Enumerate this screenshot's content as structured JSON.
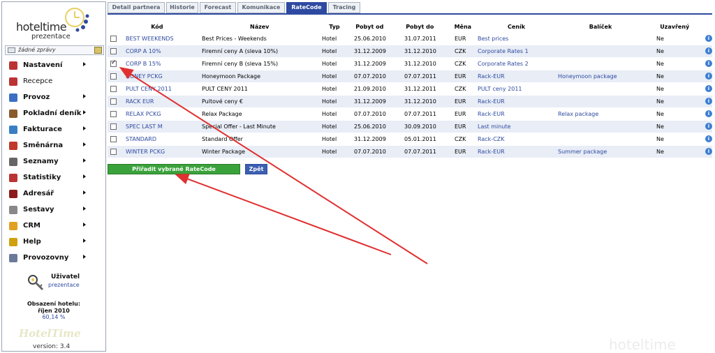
{
  "app": {
    "logo_main": "hoteltime",
    "logo_sub": "prezentace",
    "version": "version: 3.4",
    "watermark": "hoteltime",
    "bottom_logo": "HotelTime"
  },
  "messages": {
    "text": "žádné zprávy"
  },
  "menu": [
    {
      "label": "Nastavení",
      "icon": "gear-icon",
      "arrow": true,
      "color": "#b33"
    },
    {
      "label": "Recepce",
      "icon": "reception-icon",
      "arrow": false,
      "color": "#b33"
    },
    {
      "label": "Provoz",
      "icon": "globe-icon",
      "arrow": true,
      "color": "#3a6fc4"
    },
    {
      "label": "Pokladní deník",
      "icon": "cashbook-icon",
      "arrow": true,
      "color": "#8a5a2a"
    },
    {
      "label": "Fakturace",
      "icon": "invoice-icon",
      "arrow": true,
      "color": "#3a7fc4"
    },
    {
      "label": "Směnárna",
      "icon": "exchange-icon",
      "arrow": true,
      "color": "#c0392b"
    },
    {
      "label": "Seznamy",
      "icon": "list-icon",
      "arrow": true,
      "color": "#666"
    },
    {
      "label": "Statistiky",
      "icon": "chart-icon",
      "arrow": true,
      "color": "#b33"
    },
    {
      "label": "Adresář",
      "icon": "addressbook-icon",
      "arrow": true,
      "color": "#8b1a1a"
    },
    {
      "label": "Sestavy",
      "icon": "printer-icon",
      "arrow": true,
      "color": "#888"
    },
    {
      "label": "CRM",
      "icon": "crm-icon",
      "arrow": true,
      "color": "#e0a020"
    },
    {
      "label": "Help",
      "icon": "help-icon",
      "arrow": true,
      "color": "#d0a010"
    },
    {
      "label": "Provozovny",
      "icon": "building-icon",
      "arrow": true,
      "color": "#6a7a9a"
    }
  ],
  "user": {
    "title": "Uživatel",
    "name": "prezentace"
  },
  "occupancy": {
    "title": "Obsazení hotelu:",
    "month": "říjen 2010",
    "value": "60,14 %"
  },
  "tabs": [
    "Detail partnera",
    "Historie",
    "Forecast",
    "Komunikace",
    "RateCode",
    "Tracing"
  ],
  "active_tab": "RateCode",
  "table": {
    "headers": [
      "Kód",
      "Název",
      "Typ",
      "Pobyt od",
      "Pobyt do",
      "Měna",
      "Ceník",
      "Balíček",
      "Uzavřený"
    ],
    "rows": [
      {
        "checked": false,
        "code": "BEST WEEKENDS",
        "name": "Best Prices - Weekends",
        "type": "Hotel",
        "from": "25.06.2010",
        "to": "31.07.2011",
        "currency": "EUR",
        "pricelist": "Best prices",
        "package": "",
        "closed": "Ne"
      },
      {
        "checked": false,
        "code": "CORP A 10%",
        "name": "Firemní ceny A (sleva 10%)",
        "type": "Hotel",
        "from": "31.12.2009",
        "to": "31.12.2010",
        "currency": "CZK",
        "pricelist": "Corporate Rates 1",
        "package": "",
        "closed": "Ne"
      },
      {
        "checked": true,
        "code": "CORP B 15%",
        "name": "Firemní ceny B (sleva 15%)",
        "type": "Hotel",
        "from": "31.12.2009",
        "to": "31.12.2010",
        "currency": "CZK",
        "pricelist": "Corporate Rates 2",
        "package": "",
        "closed": "Ne"
      },
      {
        "checked": false,
        "code": "HONEY PCKG",
        "name": "Honeymoon Package",
        "type": "Hotel",
        "from": "07.07.2010",
        "to": "07.07.2011",
        "currency": "EUR",
        "pricelist": "Rack-EUR",
        "package": "Honeymoon package",
        "closed": "Ne"
      },
      {
        "checked": false,
        "code": "PULT CENY 2011",
        "name": "PULT CENY 2011",
        "type": "Hotel",
        "from": "21.09.2010",
        "to": "31.12.2011",
        "currency": "CZK",
        "pricelist": "PULT ceny 2011",
        "package": "",
        "closed": "Ne"
      },
      {
        "checked": false,
        "code": "RACK EUR",
        "name": "Pultové ceny €",
        "type": "Hotel",
        "from": "31.12.2009",
        "to": "31.12.2010",
        "currency": "EUR",
        "pricelist": "Rack-EUR",
        "package": "",
        "closed": "Ne"
      },
      {
        "checked": false,
        "code": "RELAX PCKG",
        "name": "Relax Package",
        "type": "Hotel",
        "from": "07.07.2010",
        "to": "07.07.2011",
        "currency": "EUR",
        "pricelist": "Rack-EUR",
        "package": "Relax package",
        "closed": "Ne"
      },
      {
        "checked": false,
        "code": "SPEC LAST M",
        "name": "Special Offer - Last Minute",
        "type": "Hotel",
        "from": "25.06.2010",
        "to": "30.09.2010",
        "currency": "EUR",
        "pricelist": "Last minute",
        "package": "",
        "closed": "Ne"
      },
      {
        "checked": false,
        "code": "STANDARD",
        "name": "Standard Offer",
        "type": "Hotel",
        "from": "31.12.2009",
        "to": "05.01.2011",
        "currency": "CZK",
        "pricelist": "Rack-CZK",
        "package": "",
        "closed": "Ne"
      },
      {
        "checked": false,
        "code": "WINTER PCKG",
        "name": "Winter Package",
        "type": "Hotel",
        "from": "07.07.2010",
        "to": "07.07.2011",
        "currency": "EUR",
        "pricelist": "Rack-EUR",
        "package": "Summer package",
        "closed": "Ne"
      }
    ]
  },
  "buttons": {
    "assign": "Přiřadit vybrané RateCode",
    "back": "Zpět"
  },
  "colors": {
    "accent": "#2e4aa0",
    "button_green": "#3aa23a",
    "row_alt": "#e8edf6",
    "annotation_arrow": "#e03030"
  }
}
